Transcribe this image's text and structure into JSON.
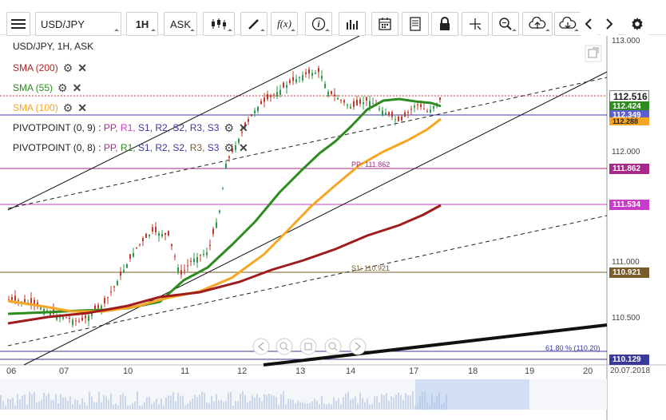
{
  "toolbar": {
    "symbol": "USD/JPY",
    "timeframe": "1H",
    "price_type": "ASK",
    "fx_label": "f(x)"
  },
  "chart": {
    "title": "USD/JPY, 1H, ASK",
    "legend": [
      {
        "label": "SMA (200)",
        "color": "#b22222"
      },
      {
        "label": "SMA (55)",
        "color": "#2e8b20"
      },
      {
        "label": "SMA (100)",
        "color": "#f5a623"
      }
    ],
    "pivot1": {
      "prefix": "PIVOTPOINT (0, 9)",
      "sep": " : ",
      "items": [
        "PP,",
        "R1,",
        "S1,",
        "R2,",
        "S2,",
        "R3,",
        "S3"
      ]
    },
    "pivot2": {
      "prefix": "PIVOTPOINT (0, 8)",
      "sep": " : ",
      "items": [
        "PP,",
        "R1,",
        "S1,",
        "R2,",
        "S2,",
        "R3,",
        "S3"
      ]
    },
    "annotations": {
      "pp": "PP: 111.862",
      "s1": "S1: 110.921",
      "fib": "61.80 % (110.20)"
    },
    "price_axis": [
      "113.000",
      "112.000",
      "111.000",
      "110.500"
    ],
    "price_tags": [
      {
        "value": "112.516",
        "color": "#ffffff",
        "text": "#222222",
        "border": "#888888"
      },
      {
        "value": "112.424",
        "color": "#2e8b20",
        "text": "#ffffff"
      },
      {
        "value": "112.349",
        "color": "#5a5fd0",
        "text": "#ffffff"
      },
      {
        "value": "112.288",
        "color": "#f5a623",
        "text": "#222222"
      },
      {
        "value": "111.862",
        "color": "#a52a8a",
        "text": "#ffffff"
      },
      {
        "value": "111.534",
        "color": "#c93cc9",
        "text": "#ffffff"
      },
      {
        "value": "110.921",
        "color": "#7a5c2a",
        "text": "#ffffff"
      },
      {
        "value": "110.129",
        "color": "#3a3a9a",
        "text": "#ffffff"
      }
    ],
    "time_axis": [
      "06",
      "07",
      "10",
      "11",
      "12",
      "13",
      "14",
      "17",
      "18",
      "19",
      "20"
    ],
    "date_label": "20.07.2018"
  }
}
